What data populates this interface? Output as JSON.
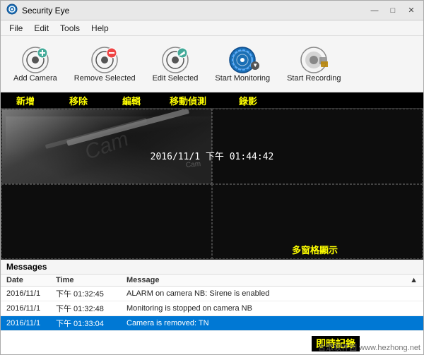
{
  "app": {
    "title": "Security Eye",
    "title_icon": "🔵"
  },
  "titlebar": {
    "minimize_label": "—",
    "maximize_label": "□",
    "close_label": "✕"
  },
  "menubar": {
    "items": [
      {
        "label": "File"
      },
      {
        "label": "Edit"
      },
      {
        "label": "Tools"
      },
      {
        "label": "Help"
      }
    ]
  },
  "toolbar": {
    "buttons": [
      {
        "id": "add-camera",
        "label": "Add Camera"
      },
      {
        "id": "remove-selected",
        "label": "Remove Selected"
      },
      {
        "id": "edit-selected",
        "label": "Edit Selected"
      },
      {
        "id": "start-monitoring",
        "label": "Start Monitoring"
      },
      {
        "id": "start-recording",
        "label": "Start Recording"
      }
    ]
  },
  "chinese_labels": {
    "add": "新增",
    "remove": "移除",
    "edit": "編輯",
    "motion": "移動偵測",
    "record": "錄影"
  },
  "camera_grid": {
    "timestamp": "2016/11/1  下午  01:44:42",
    "multi_window_label": "多窗格顯示"
  },
  "messages": {
    "header": "Messages",
    "columns": [
      "Date",
      "Time",
      "Message"
    ],
    "sort_icon": "▲",
    "rows": [
      {
        "date": "2016/11/1",
        "time": "下午 01:32:45",
        "message": "ALARM on camera NB: Sirene is enabled",
        "selected": false
      },
      {
        "date": "2016/11/1",
        "time": "下午 01:32:48",
        "message": "Monitoring is stopped on camera NB",
        "selected": false
      },
      {
        "date": "2016/11/1",
        "time": "下午 01:33:04",
        "message": "Camera is removed: TN",
        "selected": true
      }
    ],
    "realtime_label": "即時記錄"
  },
  "watermark": {
    "text": "合眾软件园",
    "url_text": "www.hezhong.net"
  }
}
